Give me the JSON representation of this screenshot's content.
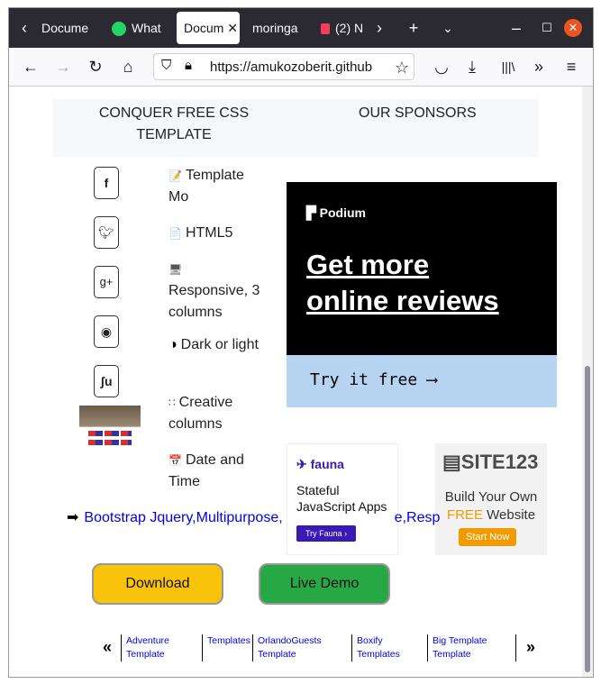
{
  "browser": {
    "tabs": [
      {
        "label": "Docume",
        "icon": "page-icon"
      },
      {
        "label": "What",
        "icon": "whatsapp-icon"
      },
      {
        "label": "Docum",
        "icon": "page-icon",
        "active": true
      },
      {
        "label": "moringa",
        "icon": "none"
      },
      {
        "label": "(2) N",
        "icon": "pocket-icon"
      }
    ],
    "url": "https://amukozoberit.github"
  },
  "header": {
    "left_title": "CONQUER FREE CSS TEMPLATE",
    "right_title": "OUR SPONSORS"
  },
  "social": [
    "f",
    "t",
    "g+",
    "reddit",
    "su"
  ],
  "features": [
    {
      "icon": "📝",
      "text": "Template Mo"
    },
    {
      "icon": "📄",
      "text": "HTML5"
    },
    {
      "icon": "🖥",
      "text": "Responsive, 3 columns"
    },
    {
      "icon": "◑",
      "text": "Dark or light"
    },
    {
      "icon": "∷",
      "text": "Creative columns"
    },
    {
      "icon": "📅",
      "text": "Date and Time"
    }
  ],
  "ads": {
    "podium": {
      "brand": "Podium",
      "headline_1": "Get more",
      "headline_2": "online reviews",
      "cta": "Try it free ⟶"
    },
    "fauna": {
      "brand": "fauna",
      "text": "Stateful JavaScript Apps",
      "button": "Try Fauna ›"
    },
    "site123": {
      "brand": "SITE123",
      "line1": "Build Your Own",
      "free": "FREE",
      "line2": " Website",
      "button": "Start Now"
    }
  },
  "tags_line": "Bootstrap Jquery,Multipurpose,",
  "tags_tail": "e,Resp",
  "buttons": {
    "download": "Download",
    "live_demo": "Live Demo"
  },
  "pager": [
    {
      "line1": "Adventure",
      "line2": "Template"
    },
    {
      "line1": "Templates",
      "line2": ""
    },
    {
      "line1": "OrlandoGuests",
      "line2": "Template"
    },
    {
      "line1": "Boxify",
      "line2": "Templates"
    },
    {
      "line1": "Big Template",
      "line2": "Template"
    }
  ],
  "colors": {
    "download": "#f8c30a",
    "live_demo": "#28a745",
    "tabbar": "#2b2a33"
  }
}
